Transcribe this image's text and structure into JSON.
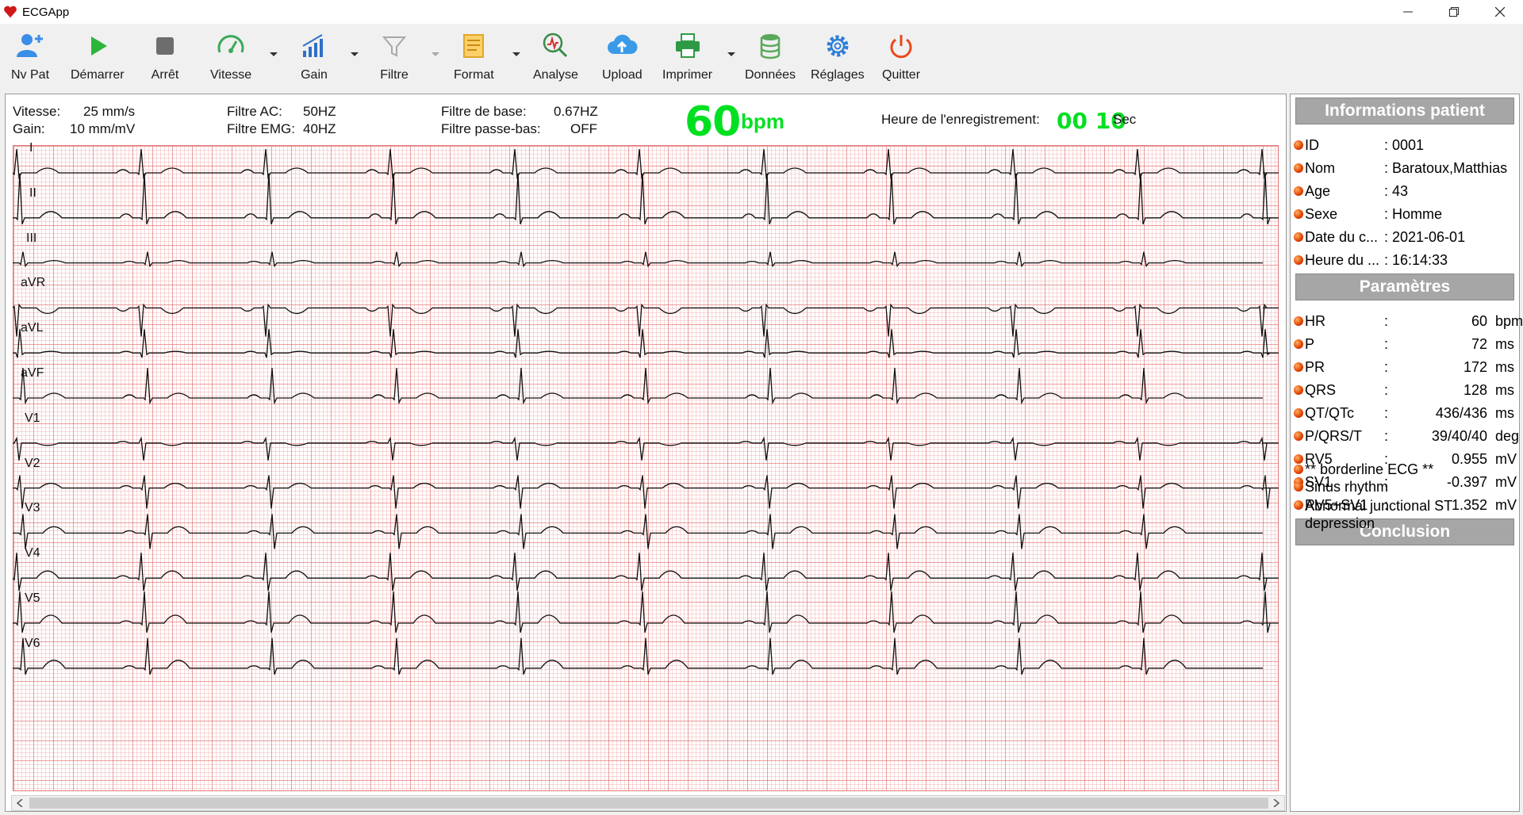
{
  "window": {
    "title": "ECGApp"
  },
  "toolbar": {
    "items": [
      {
        "label": "Nv Pat",
        "icon": "add-user-icon"
      },
      {
        "label": "Démarrer",
        "icon": "play-icon"
      },
      {
        "label": "Arrêt",
        "icon": "stop-icon"
      },
      {
        "label": "Vitesse",
        "icon": "speedometer-icon"
      },
      {
        "label": "Gain",
        "icon": "signal-bars-icon"
      },
      {
        "label": "Filtre",
        "icon": "funnel-icon"
      },
      {
        "label": "Format",
        "icon": "list-document-icon"
      },
      {
        "label": "Analyse",
        "icon": "magnifier-chart-icon"
      },
      {
        "label": "Upload",
        "icon": "cloud-upload-icon"
      },
      {
        "label": "Imprimer",
        "icon": "printer-icon"
      },
      {
        "label": "Données",
        "icon": "database-icon"
      },
      {
        "label": "Réglages",
        "icon": "gear-icon"
      },
      {
        "label": "Quitter",
        "icon": "power-icon"
      }
    ]
  },
  "ecg_header": {
    "speed_label": "Vitesse:",
    "speed_value": "25 mm/s",
    "gain_label": "Gain:",
    "gain_value": "10 mm/mV",
    "ac_label": "Filtre AC:",
    "ac_value": "50HZ",
    "emg_label": "Filtre EMG:",
    "emg_value": "40HZ",
    "base_label": "Filtre de base:",
    "base_value": "0.67HZ",
    "lowpass_label": "Filtre passe-bas:",
    "lowpass_value": "OFF",
    "bpm_value": "60",
    "bpm_unit": "bpm",
    "rec_label": "Heure de l'enregistrement:",
    "rec_value": "00 10",
    "rec_unit": "Sec"
  },
  "leads": [
    "I",
    "II",
    "III",
    "aVR",
    "aVL",
    "aVF",
    "V1",
    "V2",
    "V3",
    "V4",
    "V5",
    "V6"
  ],
  "patient": {
    "title": "Informations patient",
    "rows": [
      {
        "key": "ID",
        "value": ": 0001"
      },
      {
        "key": "Nom",
        "value": ": Baratoux,Matthias"
      },
      {
        "key": "Age",
        "value": ": 43"
      },
      {
        "key": "Sexe",
        "value": ": Homme"
      },
      {
        "key": "Date du c...",
        "value": ": 2021-06-01"
      },
      {
        "key": "Heure du ...",
        "value": ": 16:14:33"
      }
    ]
  },
  "params": {
    "title": "Paramètres",
    "rows": [
      {
        "key": "HR",
        "value": "60",
        "unit": "bpm"
      },
      {
        "key": "P",
        "value": "72",
        "unit": "ms"
      },
      {
        "key": "PR",
        "value": "172",
        "unit": "ms"
      },
      {
        "key": "QRS",
        "value": "128",
        "unit": "ms"
      },
      {
        "key": "QT/QTc",
        "value": "436/436",
        "unit": "ms"
      },
      {
        "key": "P/QRS/T",
        "value": "39/40/40",
        "unit": "deg"
      },
      {
        "key": "RV5",
        "value": "0.955",
        "unit": "mV"
      },
      {
        "key": "SV1",
        "value": "-0.397",
        "unit": "mV"
      },
      {
        "key": "RV5+SV1",
        "value": "1.352",
        "unit": "mV"
      }
    ],
    "colon": ":"
  },
  "conclusion": {
    "title": "Conclusion",
    "lines": [
      "** borderline ECG **",
      "Sinus rhythm",
      "Abnormal junctional ST",
      "depression"
    ]
  },
  "colors": {
    "accent_green": "#00e020",
    "grid_red": "#e27a7a",
    "trace": "#111111"
  }
}
